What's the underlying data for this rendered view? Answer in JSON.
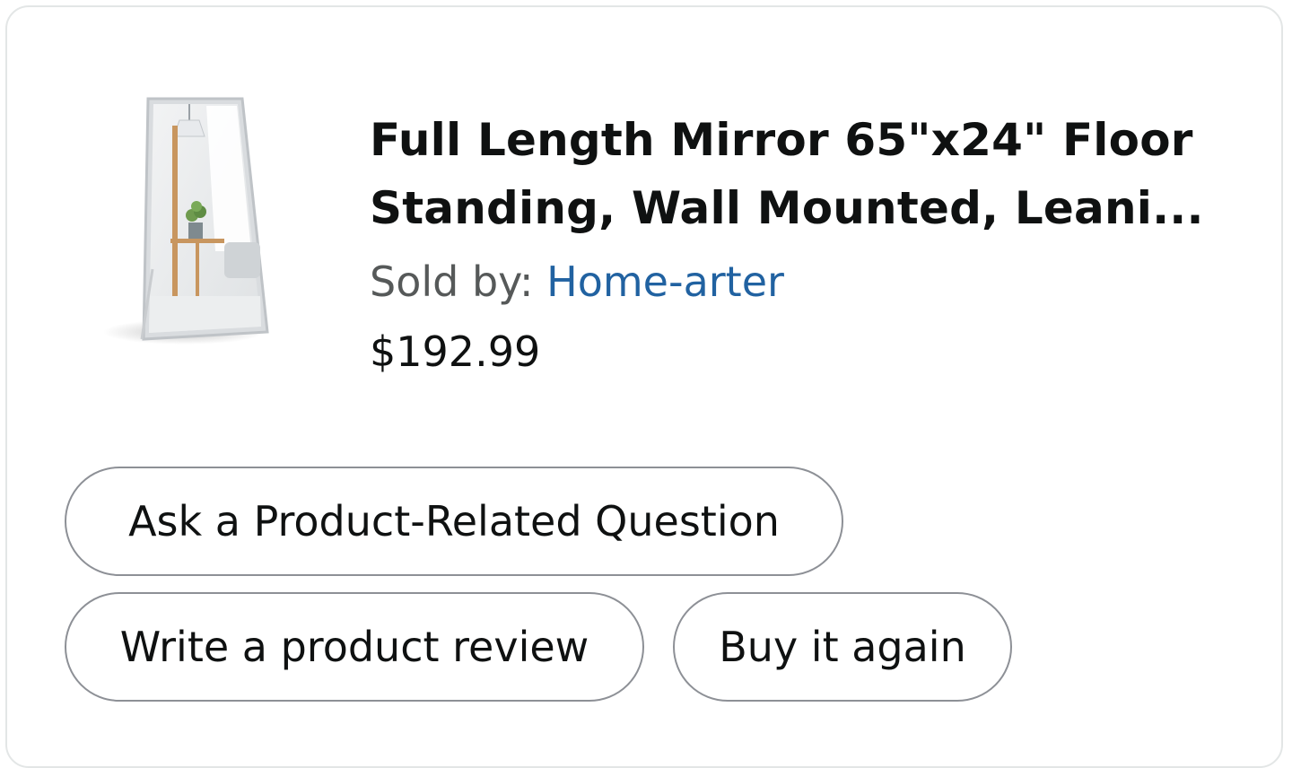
{
  "product": {
    "title_line1": "Full Length Mirror 65\"x24\" Floor",
    "title_line2": "Standing, Wall Mounted, Leani...",
    "sold_by_label": "Sold by: ",
    "seller_name": "Home-arter",
    "price": "$192.99",
    "image_icon": "floor-mirror-product-photo"
  },
  "actions": {
    "ask_question": "Ask a Product-Related Question",
    "write_review": "Write a product review",
    "buy_again": "Buy it again"
  },
  "colors": {
    "seller_link": "#2162a1",
    "label_gray": "#565959",
    "text_dark": "#0f1111",
    "pill_border": "#8d9096"
  }
}
